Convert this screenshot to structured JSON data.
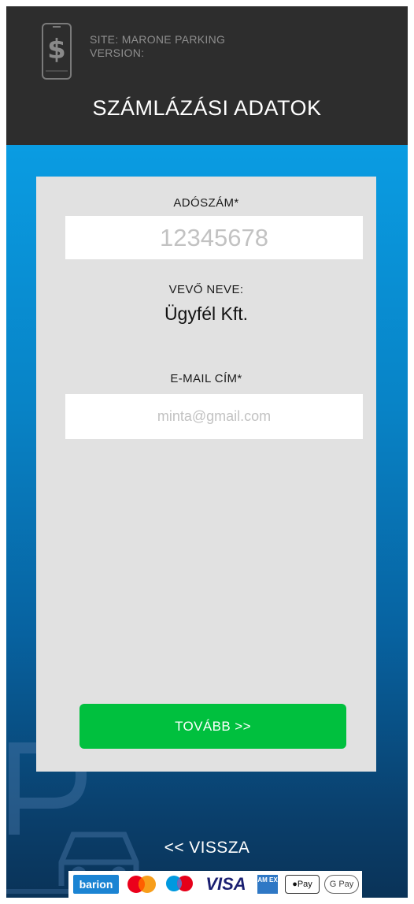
{
  "header": {
    "site_line": "SITE: MARONE PARKING",
    "version_line": "VERSION:",
    "title": "SZÁMLÁZÁSI ADATOK"
  },
  "form": {
    "tax_label": "ADÓSZÁM*",
    "tax_placeholder": "12345678",
    "tax_value": "",
    "buyer_label": "VEVŐ NEVE:",
    "buyer_name": "Ügyfél Kft.",
    "email_label": "E-MAIL CÍM*",
    "email_placeholder": "minta@gmail.com",
    "email_value": ""
  },
  "actions": {
    "next_label": "TOVÁBB >>",
    "back_label": "<< VISSZA"
  },
  "payments": {
    "barion": "barion",
    "visa": "VISA",
    "amex": "AM EX",
    "applepay": "Pay",
    "gpay": "G Pay"
  },
  "colors": {
    "header_bg": "#2d2d2d",
    "accent_blue": "#0a9ce2",
    "button_green": "#00c03e",
    "card_bg": "#e1e1e1"
  }
}
